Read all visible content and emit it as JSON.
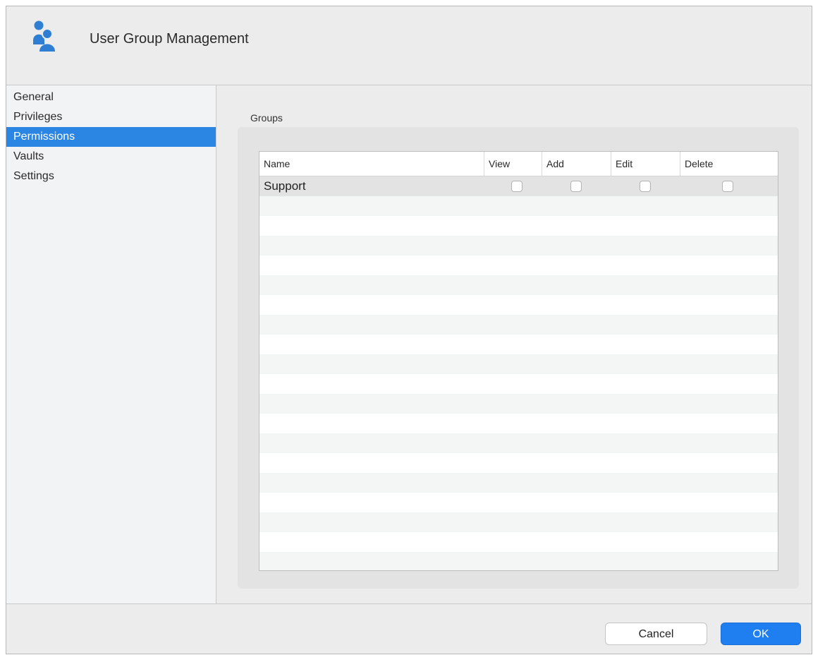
{
  "window": {
    "title": "User Group Management",
    "icon": "users-group-icon",
    "accent_color": "#2b86e3"
  },
  "sidebar": {
    "items": [
      {
        "label": "General",
        "selected": false
      },
      {
        "label": "Privileges",
        "selected": false
      },
      {
        "label": "Permissions",
        "selected": true
      },
      {
        "label": "Vaults",
        "selected": false
      },
      {
        "label": "Settings",
        "selected": false
      }
    ]
  },
  "groups": {
    "label": "Groups",
    "columns": [
      "Name",
      "View",
      "Add",
      "Edit",
      "Delete"
    ],
    "rows": [
      {
        "name": "Support",
        "view": false,
        "add": false,
        "edit": false,
        "delete": false
      }
    ]
  },
  "footer": {
    "cancel_label": "Cancel",
    "ok_label": "OK"
  }
}
